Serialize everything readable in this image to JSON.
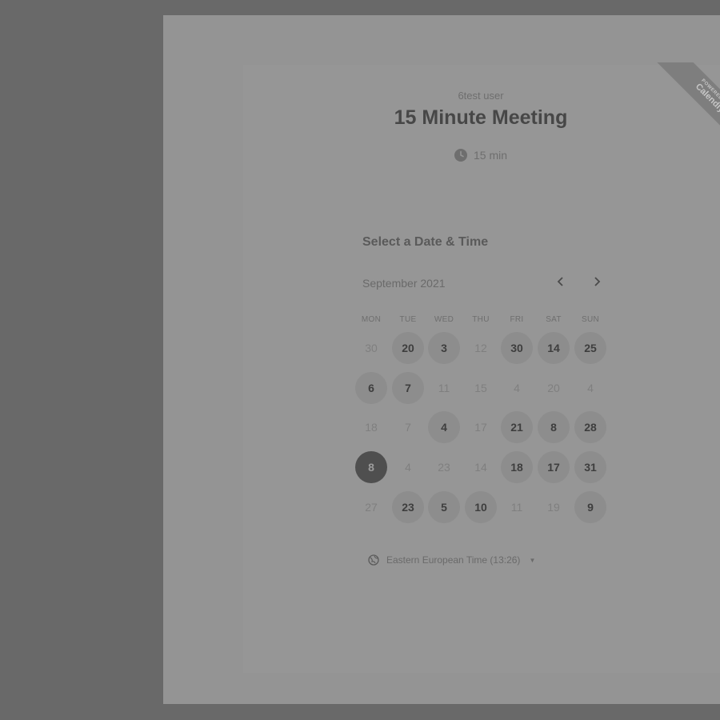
{
  "event": {
    "host": "6test user",
    "title": "15 Minute Meeting",
    "duration": "15 min"
  },
  "badge": {
    "powered_by": "POWERED BY",
    "brand": "Calendly"
  },
  "scheduler": {
    "heading": "Select a Date & Time",
    "month_label": "September 2021",
    "weekdays": [
      "MON",
      "TUE",
      "WED",
      "THU",
      "FRI",
      "SAT",
      "SUN"
    ],
    "weeks": [
      [
        {
          "d": "30",
          "s": "disabled"
        },
        {
          "d": "20",
          "s": "available"
        },
        {
          "d": "3",
          "s": "available"
        },
        {
          "d": "12",
          "s": "disabled"
        },
        {
          "d": "30",
          "s": "available"
        },
        {
          "d": "14",
          "s": "available"
        },
        {
          "d": "25",
          "s": "available"
        }
      ],
      [
        {
          "d": "6",
          "s": "available"
        },
        {
          "d": "7",
          "s": "available"
        },
        {
          "d": "11",
          "s": "disabled"
        },
        {
          "d": "15",
          "s": "disabled"
        },
        {
          "d": "4",
          "s": "disabled"
        },
        {
          "d": "20",
          "s": "disabled"
        },
        {
          "d": "4",
          "s": "disabled"
        }
      ],
      [
        {
          "d": "18",
          "s": "disabled"
        },
        {
          "d": "7",
          "s": "disabled"
        },
        {
          "d": "4",
          "s": "available"
        },
        {
          "d": "17",
          "s": "disabled"
        },
        {
          "d": "21",
          "s": "available"
        },
        {
          "d": "8",
          "s": "available"
        },
        {
          "d": "28",
          "s": "available"
        }
      ],
      [
        {
          "d": "8",
          "s": "selected"
        },
        {
          "d": "4",
          "s": "disabled"
        },
        {
          "d": "23",
          "s": "disabled"
        },
        {
          "d": "14",
          "s": "disabled"
        },
        {
          "d": "18",
          "s": "available"
        },
        {
          "d": "17",
          "s": "available"
        },
        {
          "d": "31",
          "s": "available"
        }
      ],
      [
        {
          "d": "27",
          "s": "disabled"
        },
        {
          "d": "23",
          "s": "available"
        },
        {
          "d": "5",
          "s": "available"
        },
        {
          "d": "10",
          "s": "available"
        },
        {
          "d": "11",
          "s": "disabled"
        },
        {
          "d": "19",
          "s": "disabled"
        },
        {
          "d": "9",
          "s": "available"
        }
      ]
    ],
    "timezone": "Eastern European Time (13:26)"
  },
  "icons": {
    "clock": "clock-icon",
    "prev": "chevron-left-icon",
    "next": "chevron-right-icon",
    "globe": "globe-icon",
    "caret": "caret-down-icon"
  },
  "colors": {
    "overlay": "#696969",
    "panel": "#949494",
    "selected_day": "#4f4f4f",
    "available_day": "#8d8d8d"
  }
}
